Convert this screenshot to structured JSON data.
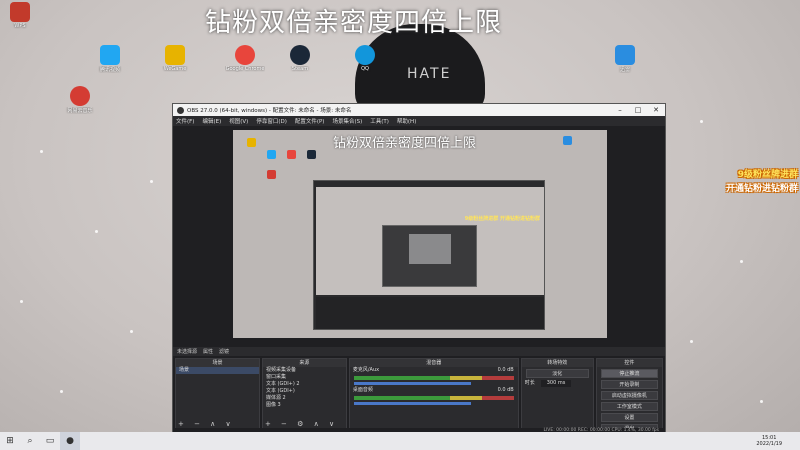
{
  "banner": "钻粉双倍亲密度四倍上限",
  "promo": {
    "line1": "9级粉丝牌进群",
    "line2": "开通钻粉进钻粉群"
  },
  "hat_text": "HATE",
  "desktop_icons": [
    {
      "label": "Google Chrome",
      "color": "#e8453c"
    },
    {
      "label": "Steam",
      "color": "#1b2838"
    },
    {
      "label": "QQ",
      "color": "#1296db"
    },
    {
      "label": "WeGame",
      "color": "#e7b300"
    },
    {
      "label": "网易云音乐",
      "color": "#d43c33"
    },
    {
      "label": "腾讯视频",
      "color": "#21a7f2"
    },
    {
      "label": "WPS",
      "color": "#c23a2b"
    },
    {
      "label": "迅雷",
      "color": "#2a8de0"
    }
  ],
  "obs": {
    "title": "OBS 27.0.0 (64-bit, windows) - 配置文件: 未命名 - 场景: 未命名",
    "menu": [
      "文件(F)",
      "编辑(E)",
      "视图(V)",
      "停靠窗口(D)",
      "配置文件(P)",
      "场景集合(S)",
      "工具(T)",
      "帮助(H)"
    ],
    "preview_banner": "钻粉双倍亲密度四倍上限",
    "nested_promo": "9级粉丝牌进群 开通钻粉进钻粉群",
    "scene_bar": {
      "label": "未选择源",
      "props": "属性",
      "filters": "滤镜"
    },
    "docks": {
      "scenes": {
        "title": "场景",
        "items": [
          "场景"
        ]
      },
      "sources": {
        "title": "来源",
        "items": [
          "视频采集设备",
          "窗口采集",
          "文本 (GDI+) 2",
          "文本 (GDI+)",
          "媒体源 2",
          "图像 3"
        ]
      },
      "mixer": {
        "title": "混音器",
        "tracks": [
          {
            "name": "麦克风/Aux",
            "db": "0.0 dB"
          },
          {
            "name": "桌面音频",
            "db": "0.0 dB"
          }
        ]
      },
      "transitions": {
        "title": "转场特效",
        "type": "淡化",
        "duration_label": "时长",
        "duration": "300 ms"
      },
      "controls": {
        "title": "控件",
        "buttons": [
          "停止推流",
          "开始录制",
          "启动虚拟摄像机",
          "工作室模式",
          "设置",
          "退出"
        ]
      }
    },
    "status": "LIVE: 00:00:00  REC: 00:00:00  CPU: 1.4%, 30.00 fps"
  },
  "taskbar": {
    "time": "15:01",
    "date": "2022/1/19"
  },
  "colors": {
    "obs_bg": "#1f1f22",
    "accent_selected": "#3b4a66",
    "promo_yellow": "#ffe45c"
  }
}
